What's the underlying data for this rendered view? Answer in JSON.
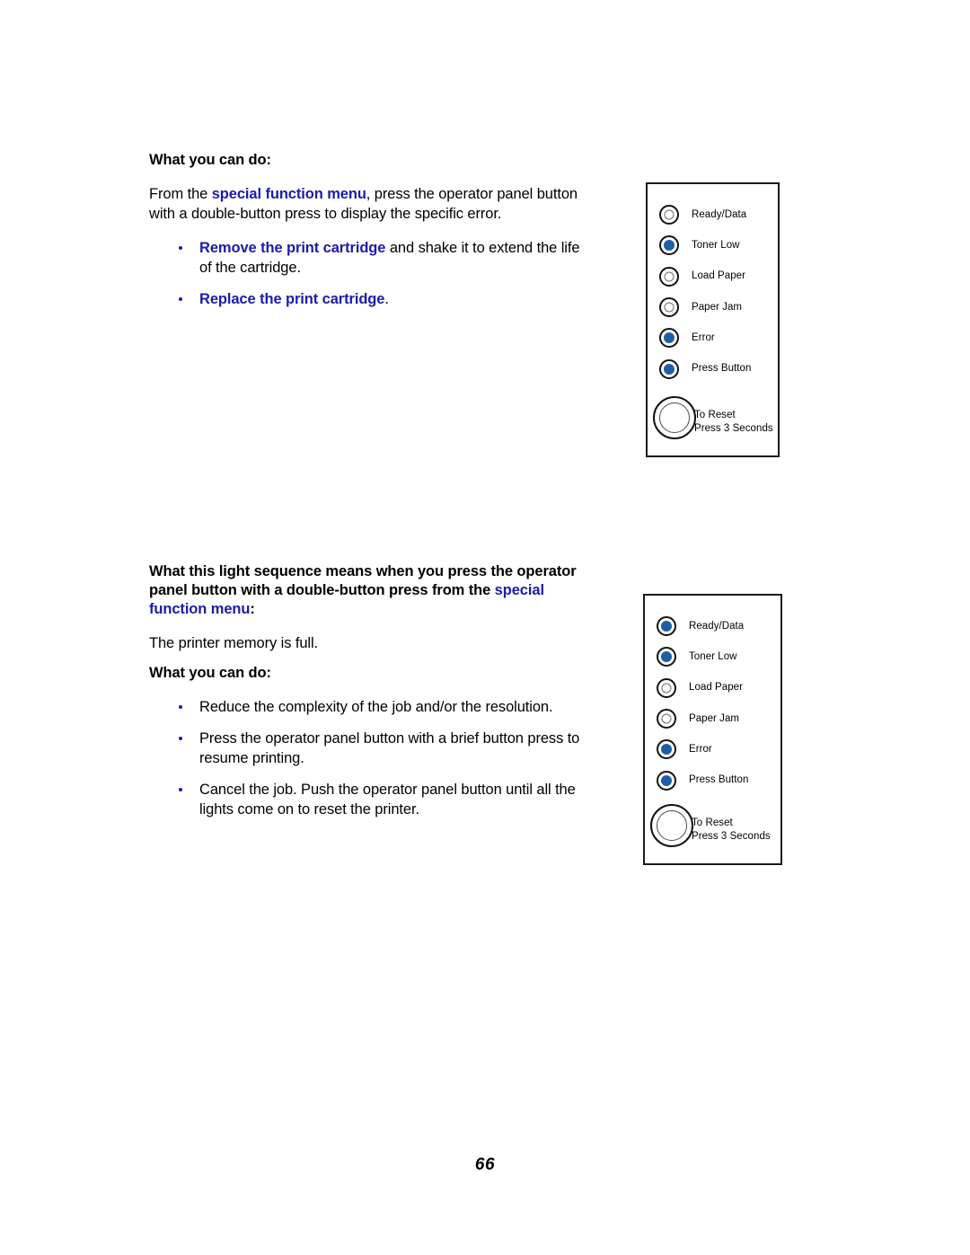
{
  "document": {
    "page_number": "66",
    "accent_blue": "#1b1bab",
    "led_on_color": "#1d5fa5",
    "led_off_color": "#ffffff"
  },
  "section_one": {
    "heading": "What you can do:",
    "paragraph": {
      "lead": "From the ",
      "emphasis": "special function menu",
      "tail": ", press the operator panel button with a double-button press to display the specific error."
    },
    "bullets": [
      {
        "emphasis": "Remove the print cartridge",
        "tail": " and shake it to extend the life of the cartridge."
      },
      {
        "emphasis": "Replace the print cartridge",
        "tail": "."
      }
    ]
  },
  "section_two": {
    "heading": {
      "lead": "What this light sequence means when you press the operator panel button with a double-button press from the ",
      "emphasis": "special function menu",
      "tail": ":"
    },
    "meaning": "The printer memory is full.",
    "subheading": "What you can do:",
    "bullets": [
      {
        "text": "Reduce the complexity of the job and/or the resolution."
      },
      {
        "text": "Press the operator panel button with a brief button press to resume printing."
      },
      {
        "text": "Cancel the job. Push the operator panel button until all the lights come on to reset the printer."
      }
    ]
  },
  "panels": [
    {
      "id": "panel-one",
      "leds": [
        {
          "label": "Ready/Data",
          "state": "off"
        },
        {
          "label": "Toner Low",
          "state": "on"
        },
        {
          "label": "Load Paper",
          "state": "off"
        },
        {
          "label": "Paper Jam",
          "state": "off"
        },
        {
          "label": "Error",
          "state": "on"
        },
        {
          "label": "Press Button",
          "state": "on"
        }
      ],
      "reset": {
        "line1": "To Reset",
        "line2": "Press 3 Seconds"
      }
    },
    {
      "id": "panel-two",
      "leds": [
        {
          "label": "Ready/Data",
          "state": "on"
        },
        {
          "label": "Toner Low",
          "state": "on"
        },
        {
          "label": "Load Paper",
          "state": "off"
        },
        {
          "label": "Paper Jam",
          "state": "off"
        },
        {
          "label": "Error",
          "state": "on"
        },
        {
          "label": "Press Button",
          "state": "on"
        }
      ],
      "reset": {
        "line1": "To Reset",
        "line2": "Press 3 Seconds"
      }
    }
  ]
}
